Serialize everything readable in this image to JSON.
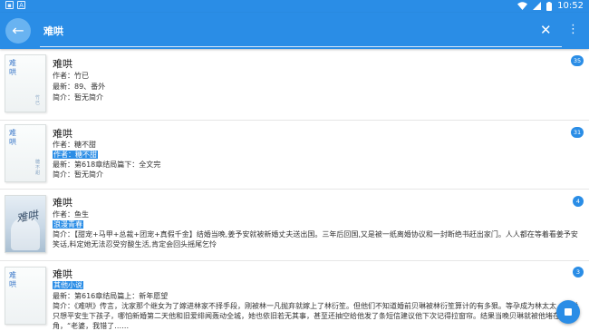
{
  "status_bar": {
    "time": "10:52",
    "left_icons": [
      "image-notification-icon",
      "app-notification-icon"
    ],
    "right_icons": [
      "wifi-icon",
      "signal-icon",
      "battery-icon"
    ]
  },
  "toolbar": {
    "back_icon": "arrow-back-icon",
    "search_value": "难哄",
    "clear_icon": "close-icon",
    "more_icon": "more-vert-icon"
  },
  "results": [
    {
      "title": "难哄",
      "cover_title": "难哄",
      "cover_author": "竹已",
      "author_line": "作者：竹已",
      "latest_line": "最新：89、番外",
      "intro_line": "简介：暂无简介",
      "badge": "35"
    },
    {
      "title": "难哄",
      "cover_title": "难哄",
      "cover_author": "糖不甜",
      "author_line": "作者：糖不甜",
      "highlight_line": "作者：糖不甜",
      "latest_line": "最新：第618章结局篇下：全文完",
      "intro_line": "简介：暂无简介",
      "badge": "31"
    },
    {
      "title": "难哄",
      "cover_text": "难哄",
      "author_line": "作者：鱼生",
      "highlight_line": "浪漫青春",
      "intro_text": "简介：【甜宠+马甲+总裁+团宠+真假千金】结婚当晚,姜予安就被新婚丈夫送出国。三年后回国,又是被一纸离婚协议和一封断绝书赶出家门。人人都在等着看姜予安笑话,料定她无法忍受穷酸生活,肯定会回头摇尾乞怜",
      "badge": "4"
    },
    {
      "title": "难哄",
      "cover_title": "难哄",
      "highlight_line": "其他小说",
      "latest_line": "最新：第616章结局篇上：新年愿望",
      "intro_text": "简介：《难哄》传言，沈家那个继女为了嫁进林家不择手段，刚被林一凡抛弃就嫁上了林衍笙。但他们不知道婚前贝琳被林衍笙算计的有多狠。等孕成为林太太，贝琳只想平安生下孩子，哪怕新婚第二天他和旧爱绯闻轰动全城，她也依旧若无其事，甚至还抽空给他发了条短信建议他下次记得拉窗帘。结果当晚贝琳就被他堵在墙角，“老婆，我错了……",
      "badge": "3"
    }
  ],
  "fab": {
    "icon": "stop-square-icon"
  },
  "colors": {
    "accent": "#2a8de6",
    "toolbar": "#2a8de6",
    "divider": "#e6e6e6"
  }
}
